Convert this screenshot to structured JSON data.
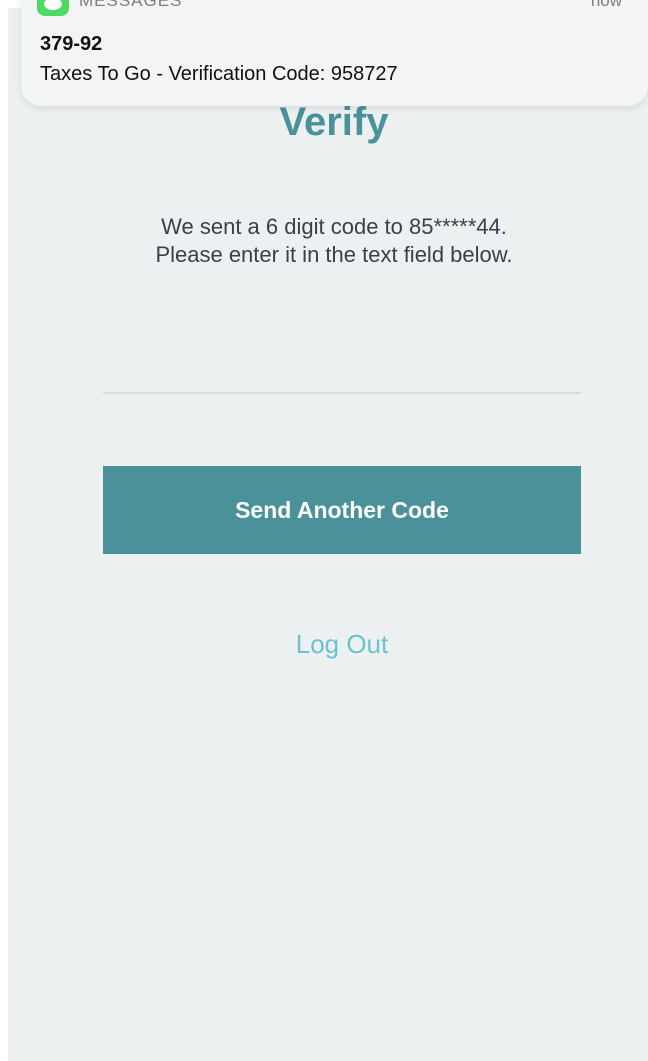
{
  "notification": {
    "app_name": "MESSAGES",
    "time": "now",
    "sender": "379-92",
    "message": "Taxes To Go - Verification Code: 958727",
    "icon": "messages-app-icon"
  },
  "page": {
    "title": "Verify",
    "instruction_line1": "We sent a 6 digit code to 85*****44.",
    "instruction_line2": "Please enter it in the text field below.",
    "code_input_value": "",
    "send_button_label": "Send Another Code",
    "logout_label": "Log Out"
  },
  "colors": {
    "accent": "#4a9199",
    "link": "#6cc3d0",
    "background": "#edf0f1",
    "notification_icon": "#4cd964"
  }
}
